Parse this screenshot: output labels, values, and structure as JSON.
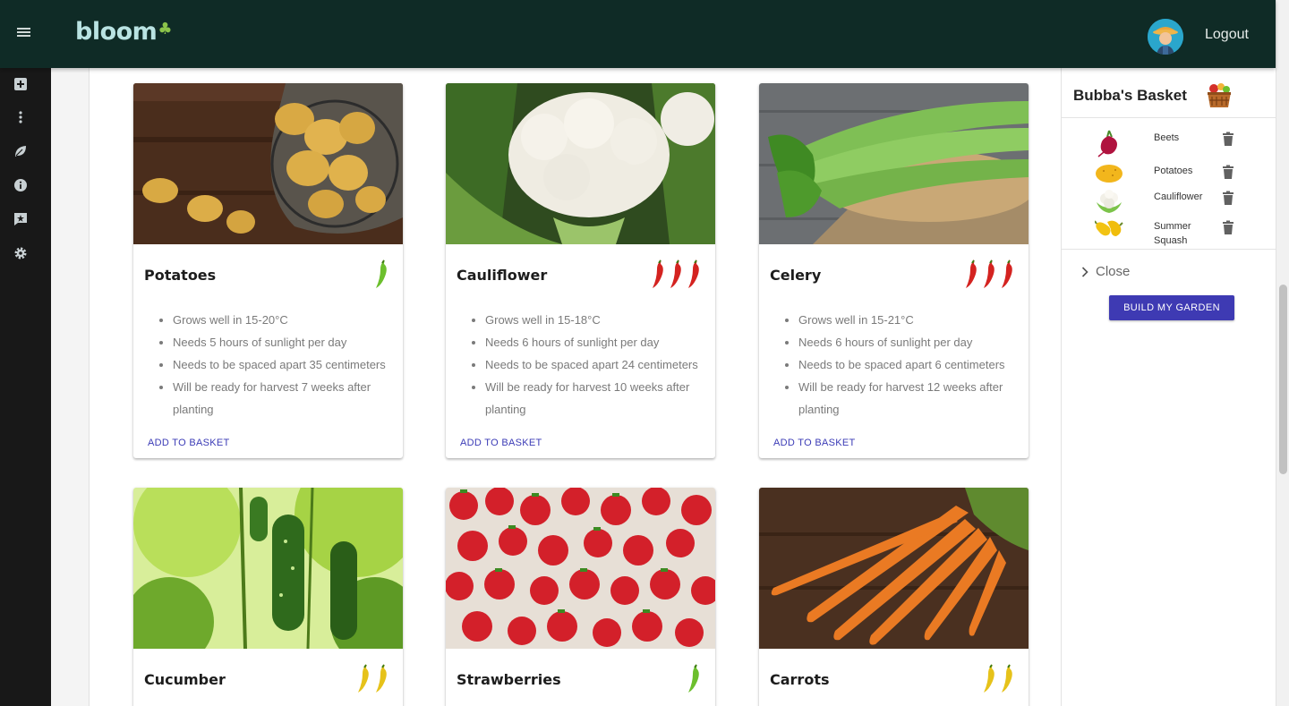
{
  "app": {
    "logo": "bloom"
  },
  "header": {
    "logout_label": "Logout"
  },
  "rail": {
    "icons": [
      "add-box-icon",
      "more-vertical-icon",
      "leaf-icon",
      "info-icon",
      "feedback-icon",
      "gear-icon"
    ]
  },
  "cards": [
    {
      "title": "Potatoes",
      "peppers": 1,
      "pepper_color": "#6cbf2d",
      "bullets": [
        "Grows well in 15-20°C",
        "Needs 5 hours of sunlight per day",
        "Needs to be spaced apart 35 centimeters",
        "Will be ready for harvest 7 weeks after planting"
      ],
      "action": "ADD TO BASKET"
    },
    {
      "title": "Cauliflower",
      "peppers": 3,
      "pepper_color": "#d42320",
      "bullets": [
        "Grows well in 15-18°C",
        "Needs 6 hours of sunlight per day",
        "Needs to be spaced apart 24 centimeters",
        "Will be ready for harvest 10 weeks after planting"
      ],
      "action": "ADD TO BASKET"
    },
    {
      "title": "Celery",
      "peppers": 3,
      "pepper_color": "#d42320",
      "bullets": [
        "Grows well in 15-21°C",
        "Needs 6 hours of sunlight per day",
        "Needs to be spaced apart 6 centimeters",
        "Will be ready for harvest 12 weeks after planting"
      ],
      "action": "ADD TO BASKET"
    },
    {
      "title": "Cucumber",
      "peppers": 2,
      "pepper_color": "#e6c21a",
      "bullets": [],
      "action": ""
    },
    {
      "title": "Strawberries",
      "peppers": 1,
      "pepper_color": "#6cbf2d",
      "bullets": [],
      "action": ""
    },
    {
      "title": "Carrots",
      "peppers": 2,
      "pepper_color": "#e6c21a",
      "bullets": [],
      "action": ""
    }
  ],
  "basket": {
    "title": "Bubba's Basket",
    "items": [
      {
        "label": "Beets",
        "icon": "beet-icon"
      },
      {
        "label": "Potatoes",
        "icon": "potato-icon"
      },
      {
        "label": "Cauliflower",
        "icon": "cauliflower-icon"
      },
      {
        "label": "Summer Squash",
        "icon": "squash-icon"
      }
    ],
    "close_label": "Close",
    "build_label": "BUILD MY GARDEN"
  }
}
